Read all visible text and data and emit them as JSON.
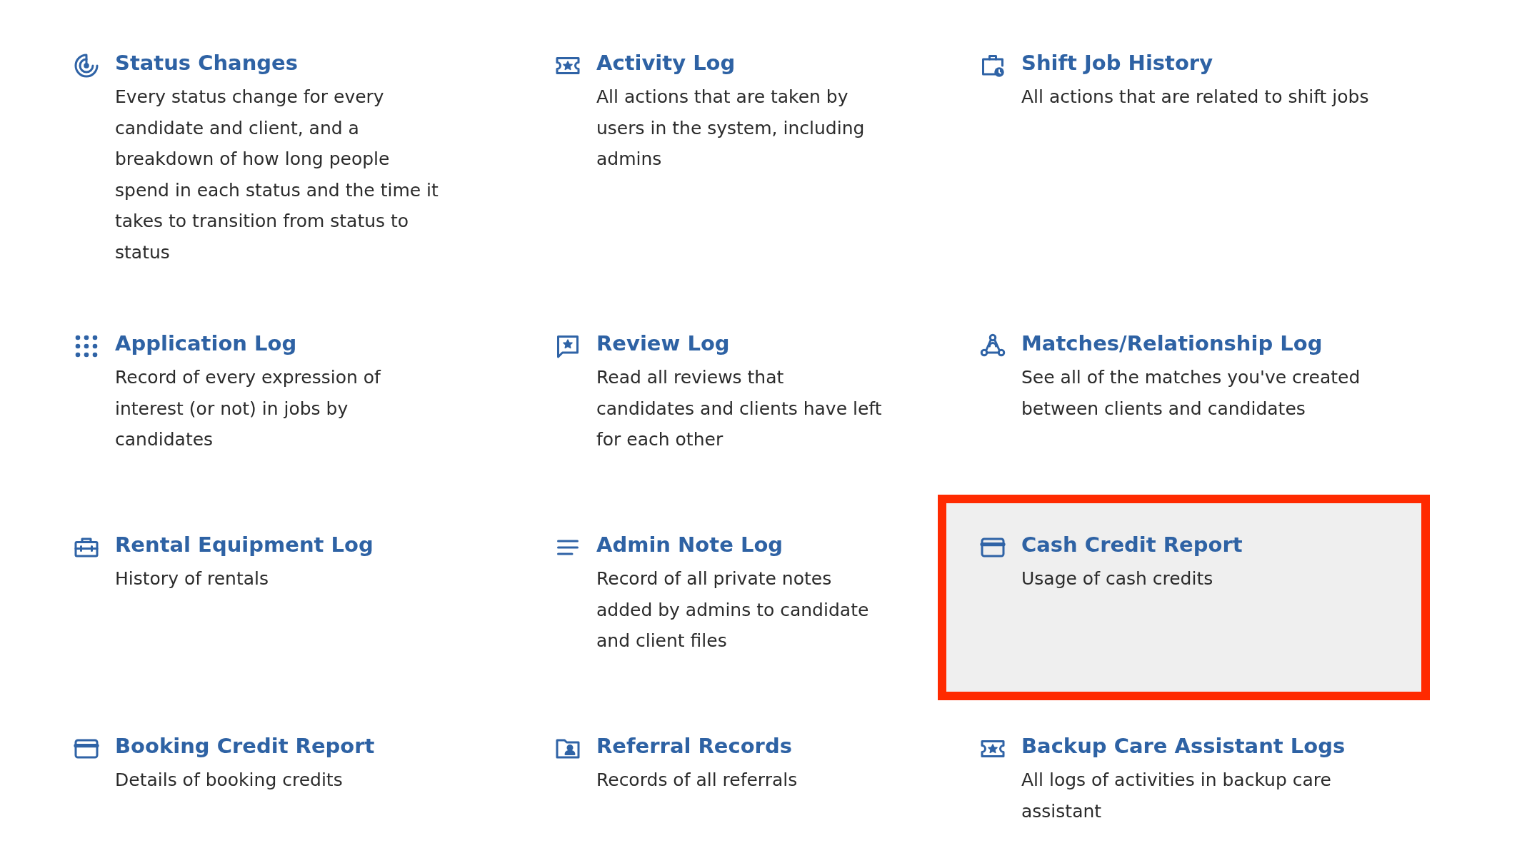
{
  "reports": [
    {
      "title": "Status Changes",
      "description": "Every status change for every candidate and client, and a breakdown of how long people spend in each status and the time it takes to transition from status to status",
      "highlighted": false
    },
    {
      "title": "Activity Log",
      "description": "All actions that are taken by users in the system, including admins",
      "highlighted": false
    },
    {
      "title": "Shift Job History",
      "description": "All actions that are related to shift jobs",
      "highlighted": false
    },
    {
      "title": "Application Log",
      "description": "Record of every expression of interest (or not) in jobs by candidates",
      "highlighted": false
    },
    {
      "title": "Review Log",
      "description": "Read all reviews that candidates and clients have left for each other",
      "highlighted": false
    },
    {
      "title": "Matches/Relationship Log",
      "description": "See all of the matches you've created between clients and candidates",
      "highlighted": false
    },
    {
      "title": "Rental Equipment Log",
      "description": "History of rentals",
      "highlighted": false
    },
    {
      "title": "Admin Note Log",
      "description": "Record of all private notes added by admins to candidate and client files",
      "highlighted": false
    },
    {
      "title": "Cash Credit Report",
      "description": "Usage of cash credits",
      "highlighted": true
    },
    {
      "title": "Booking Credit Report",
      "description": "Details of booking credits",
      "highlighted": false
    },
    {
      "title": "Referral Records",
      "description": "Records of all referrals",
      "highlighted": false
    },
    {
      "title": "Backup Care Assistant Logs",
      "description": "All logs of activities in backup care assistant",
      "highlighted": false
    }
  ]
}
